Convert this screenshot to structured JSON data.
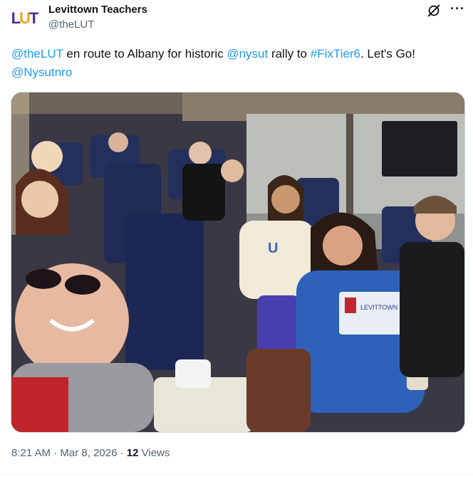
{
  "author": {
    "avatar_text": [
      "L",
      "U",
      "T"
    ],
    "name": "Levittown Teachers",
    "handle": "@theLUT"
  },
  "icons": {
    "grok": "grok-icon",
    "more": "more-icon"
  },
  "tweet": {
    "segments": [
      {
        "text": "@theLUT",
        "link": true
      },
      {
        "text": " en route to Albany for historic ",
        "link": false
      },
      {
        "text": "@nysut",
        "link": true
      },
      {
        "text": " rally to ",
        "link": false
      },
      {
        "text": "#FixTier6",
        "link": true
      },
      {
        "text": ".  Let's Go! ",
        "link": false
      },
      {
        "text": "@Nysutnro",
        "link": true
      }
    ]
  },
  "media": {
    "shirt_brand": "LEVITTOWN UNITED TEACHERS"
  },
  "meta": {
    "time": "8:21 AM",
    "sep1": " · ",
    "date": "Mar 8, 2026",
    "sep2": " · ",
    "views_count": "12",
    "views_label": " Views"
  },
  "colors": {
    "link": "#1d9bf0",
    "muted": "#536471",
    "brand_purple": "#4a2d8c",
    "brand_gold": "#f2a31b"
  }
}
